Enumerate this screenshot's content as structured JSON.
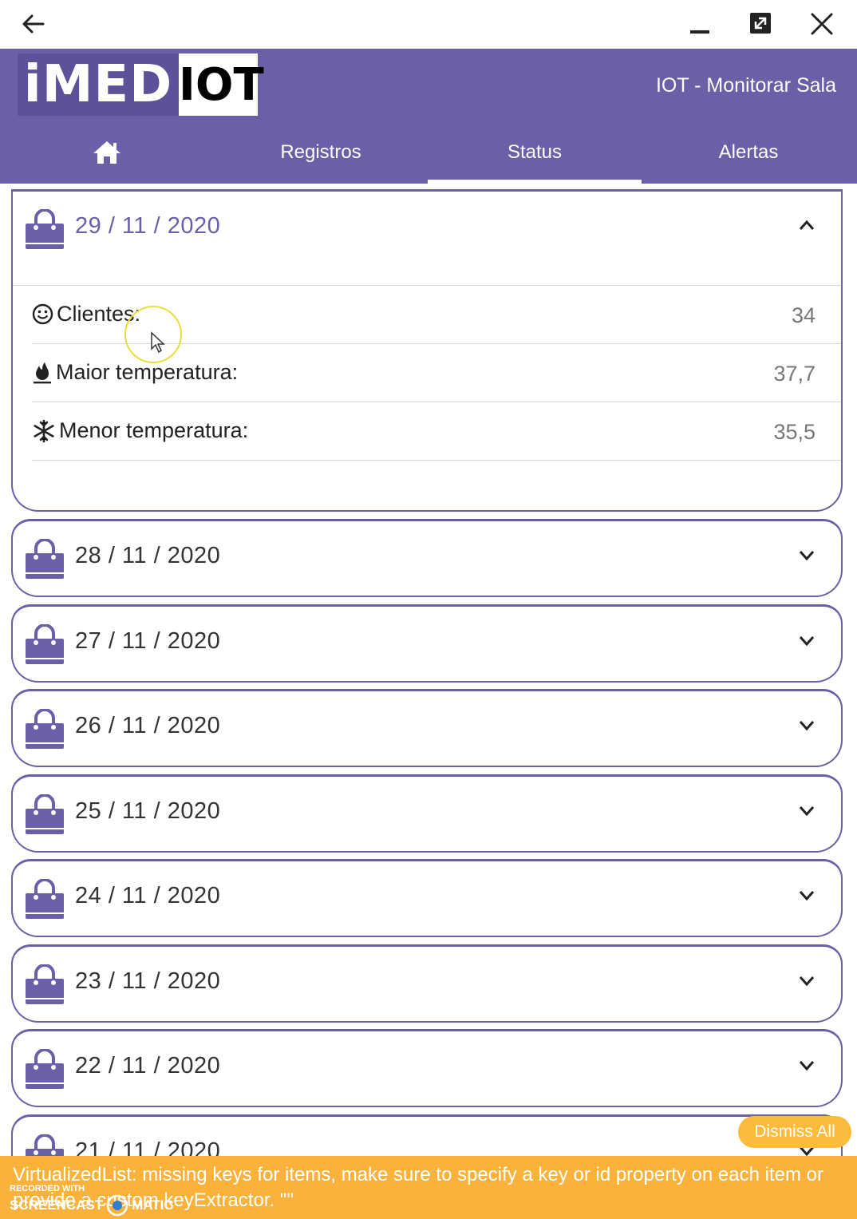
{
  "window": {
    "back_icon": "arrow-left-icon",
    "minimize_icon": "minimize-icon",
    "maximize_icon": "maximize-icon",
    "close_icon": "close-icon"
  },
  "app": {
    "logo_part1": "iMED",
    "logo_part2": "IOT",
    "title": "IOT - Monitorar Sala",
    "header_color": "#6b5fa8"
  },
  "tabs": [
    {
      "icon": "home-icon",
      "label": ""
    },
    {
      "label": "Registros"
    },
    {
      "label": "Status",
      "active": true
    },
    {
      "label": "Alertas"
    }
  ],
  "days": [
    {
      "date": "29 / 11 / 2020",
      "expanded": true,
      "stats": [
        {
          "icon": "smile-icon",
          "label": "Clientes:",
          "value": "34"
        },
        {
          "icon": "fire-icon",
          "label": "Maior temperatura:",
          "value": "37,7"
        },
        {
          "icon": "snowflake-icon",
          "label": "Menor temperatura:",
          "value": "35,5"
        }
      ]
    },
    {
      "date": "28 / 11 / 2020",
      "expanded": false
    },
    {
      "date": "27 / 11 / 2020",
      "expanded": false
    },
    {
      "date": "26 / 11 / 2020",
      "expanded": false
    },
    {
      "date": "25 / 11 / 2020",
      "expanded": false
    },
    {
      "date": "24 / 11 / 2020",
      "expanded": false
    },
    {
      "date": "23 / 11 / 2020",
      "expanded": false
    },
    {
      "date": "22 / 11 / 2020",
      "expanded": false
    },
    {
      "date": "21 / 11 / 2020",
      "expanded": false
    }
  ],
  "toast": {
    "dismiss_label": "Dismiss All",
    "message": "VirtualizedList: missing keys for items, make sure to specify a key or id property on each item or provide a custom keyExtractor. \"\"",
    "color": "#fbb23b"
  },
  "watermark": {
    "line1": "RECORDED WITH",
    "line2a": "SCREENCAST",
    "line2b": "MATIC"
  }
}
